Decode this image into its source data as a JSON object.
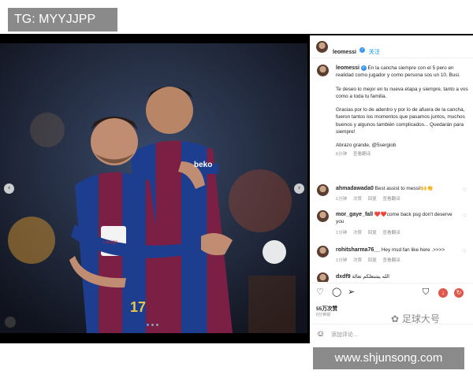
{
  "watermark_top": "TG: MYYJJPP",
  "watermark_bottom_url": "www.shjunsong.com",
  "watermark_brand": "足球大号",
  "post": {
    "username": "leomessi",
    "follow_label": "关注",
    "caption": [
      "En la cancha siempre con el 5 pero en realidad como jugador y como persona sos un 10, Busi.",
      "Te deseo lo mejor en tu nueva etapa y siempre, tanto a vos como a toda tu familia.",
      "Gracias por lo de adentro y por lo de afuera de la cancha, fueron tantos los momentos que pasamos juntos, muchos buenos y algunos también complicados... Quedarán para siempre!",
      "Abrazo grande, @5sergiob"
    ],
    "caption_time": "6分钟",
    "caption_translate": "查看翻译",
    "likes": "55万次赞",
    "posted_ago": "6分钟前",
    "add_comment_placeholder": "添加评论..."
  },
  "photo": {
    "jersey_sponsor": "beko",
    "league_badge": "LaLiga",
    "number": "17"
  },
  "comments": [
    {
      "user": "ahmadawada0",
      "text": "Best assist to messi!🙌👏",
      "time": "1分钟",
      "reply": "回复",
      "translate": "查看翻译",
      "reply_prefix": "次赞"
    },
    {
      "user": "mor_gaye_fall",
      "text": "❤️❤️come back psg don't deserve you",
      "time": "1分钟",
      "reply": "回复",
      "translate": "查看翻译",
      "reply_prefix": "次赞"
    },
    {
      "user": "rohitsharma76__",
      "text": "Hey msd fan like here .>>>>",
      "time": "1分钟",
      "reply": "回复",
      "translate": "查看翻译",
      "reply_prefix": "次赞"
    },
    {
      "user": "dxdf9",
      "text": "الله يشتغلكم تعالة",
      "time": "",
      "reply": "",
      "translate": "",
      "reply_prefix": ""
    }
  ],
  "icons": {
    "like": "heart-icon",
    "comment": "comment-icon",
    "share": "send-icon",
    "save": "bookmark-icon",
    "emoji": "smile-icon"
  },
  "colors": {
    "accent": "#0095f6",
    "verified": "#3897f0",
    "frame": "#000000",
    "watermark_bg": "#8a8a8a"
  }
}
